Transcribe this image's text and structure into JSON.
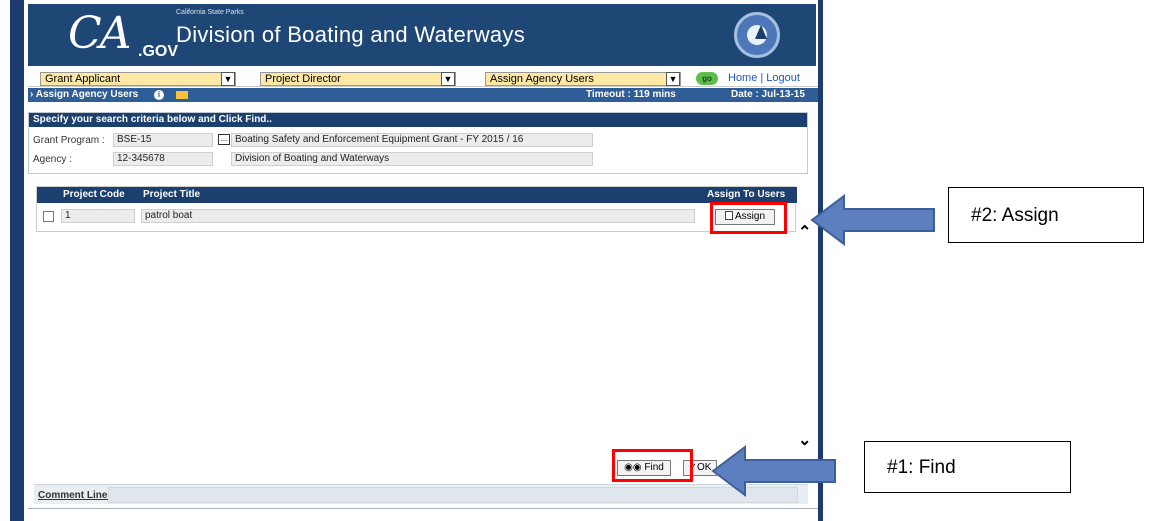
{
  "header": {
    "logo_ca": "CA",
    "logo_gov": ".GOV",
    "subtitle": "California State Parks",
    "title": "Division of Boating and Waterways"
  },
  "nav": {
    "select1": "Grant Applicant",
    "select2": "Project Director",
    "select3": "Assign Agency Users",
    "go_label": "go",
    "links": "Home | Logout"
  },
  "infobar": {
    "crumb": "Assign Agency Users",
    "timeout": "Timeout : 119 mins",
    "date": "Date : Jul-13-15"
  },
  "search_panel": {
    "heading": "Specify your search criteria below and Click Find..",
    "grant_program_label": "Grant Program :",
    "grant_program_code": "BSE-15",
    "grant_program_name": "Boating Safety and Enforcement Equipment Grant - FY 2015 / 16",
    "agency_label": "Agency :",
    "agency_code": "12-345678",
    "agency_name": "Division of Boating and Waterways"
  },
  "table": {
    "headers": [
      "Project Code",
      "Project Title",
      "Assign To Users"
    ],
    "rows": [
      {
        "project_code": "1",
        "project_title": "patrol boat",
        "action": "Assign"
      }
    ]
  },
  "footer": {
    "find_label": "Find",
    "ok_label": "OK",
    "comment_label": "Comment Line:"
  },
  "annotations": {
    "assign_callout": "#2: Assign",
    "find_callout": "#1: Find"
  },
  "colors": {
    "header_bg": "#1e4776",
    "table_header_bg": "#1b3f6e",
    "select_bg": "#fde8a6",
    "highlight": "#ff0000",
    "arrow_fill": "#5b7fbf"
  }
}
